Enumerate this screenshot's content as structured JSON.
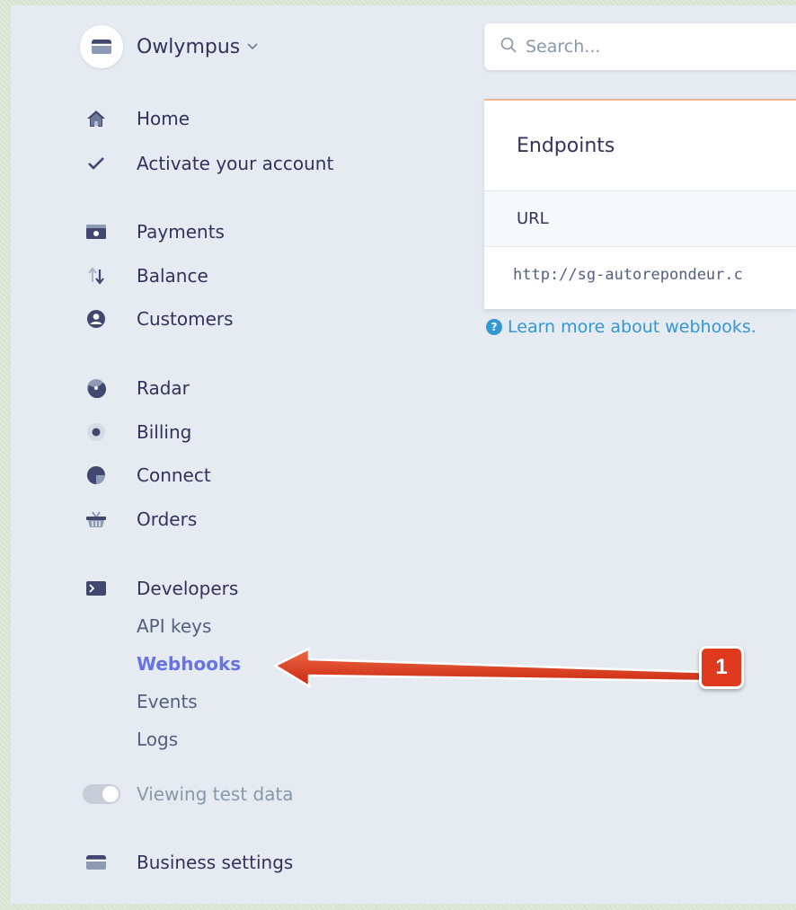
{
  "account": {
    "name": "Owlympus",
    "chevron": "⌄"
  },
  "search": {
    "placeholder": "Search..."
  },
  "sidebar": {
    "items": [
      {
        "label": "Home",
        "icon": "home-icon"
      },
      {
        "label": "Activate your account",
        "icon": "checkmark-icon"
      },
      {
        "label": "Payments",
        "icon": "payments-icon"
      },
      {
        "label": "Balance",
        "icon": "balance-arrows-icon"
      },
      {
        "label": "Customers",
        "icon": "customer-icon"
      },
      {
        "label": "Radar",
        "icon": "radar-icon"
      },
      {
        "label": "Billing",
        "icon": "billing-icon"
      },
      {
        "label": "Connect",
        "icon": "connect-icon"
      },
      {
        "label": "Orders",
        "icon": "orders-basket-icon"
      },
      {
        "label": "Developers",
        "icon": "terminal-icon"
      }
    ],
    "developer_sub": [
      {
        "label": "API keys"
      },
      {
        "label": "Webhooks",
        "active": true
      },
      {
        "label": "Events"
      },
      {
        "label": "Logs"
      }
    ],
    "test_data_label": "Viewing test data",
    "business_settings": "Business settings"
  },
  "endpoints_card": {
    "title": "Endpoints",
    "column_url": "URL",
    "row_url": "http://sg-autorepondeur.c"
  },
  "learn_more": "Learn more about webhooks.",
  "annotation": {
    "number": "1"
  },
  "colors": {
    "accent": "#6772e5",
    "link": "#3297d3",
    "text": "#32325d",
    "arrow": "#e03a1e"
  }
}
